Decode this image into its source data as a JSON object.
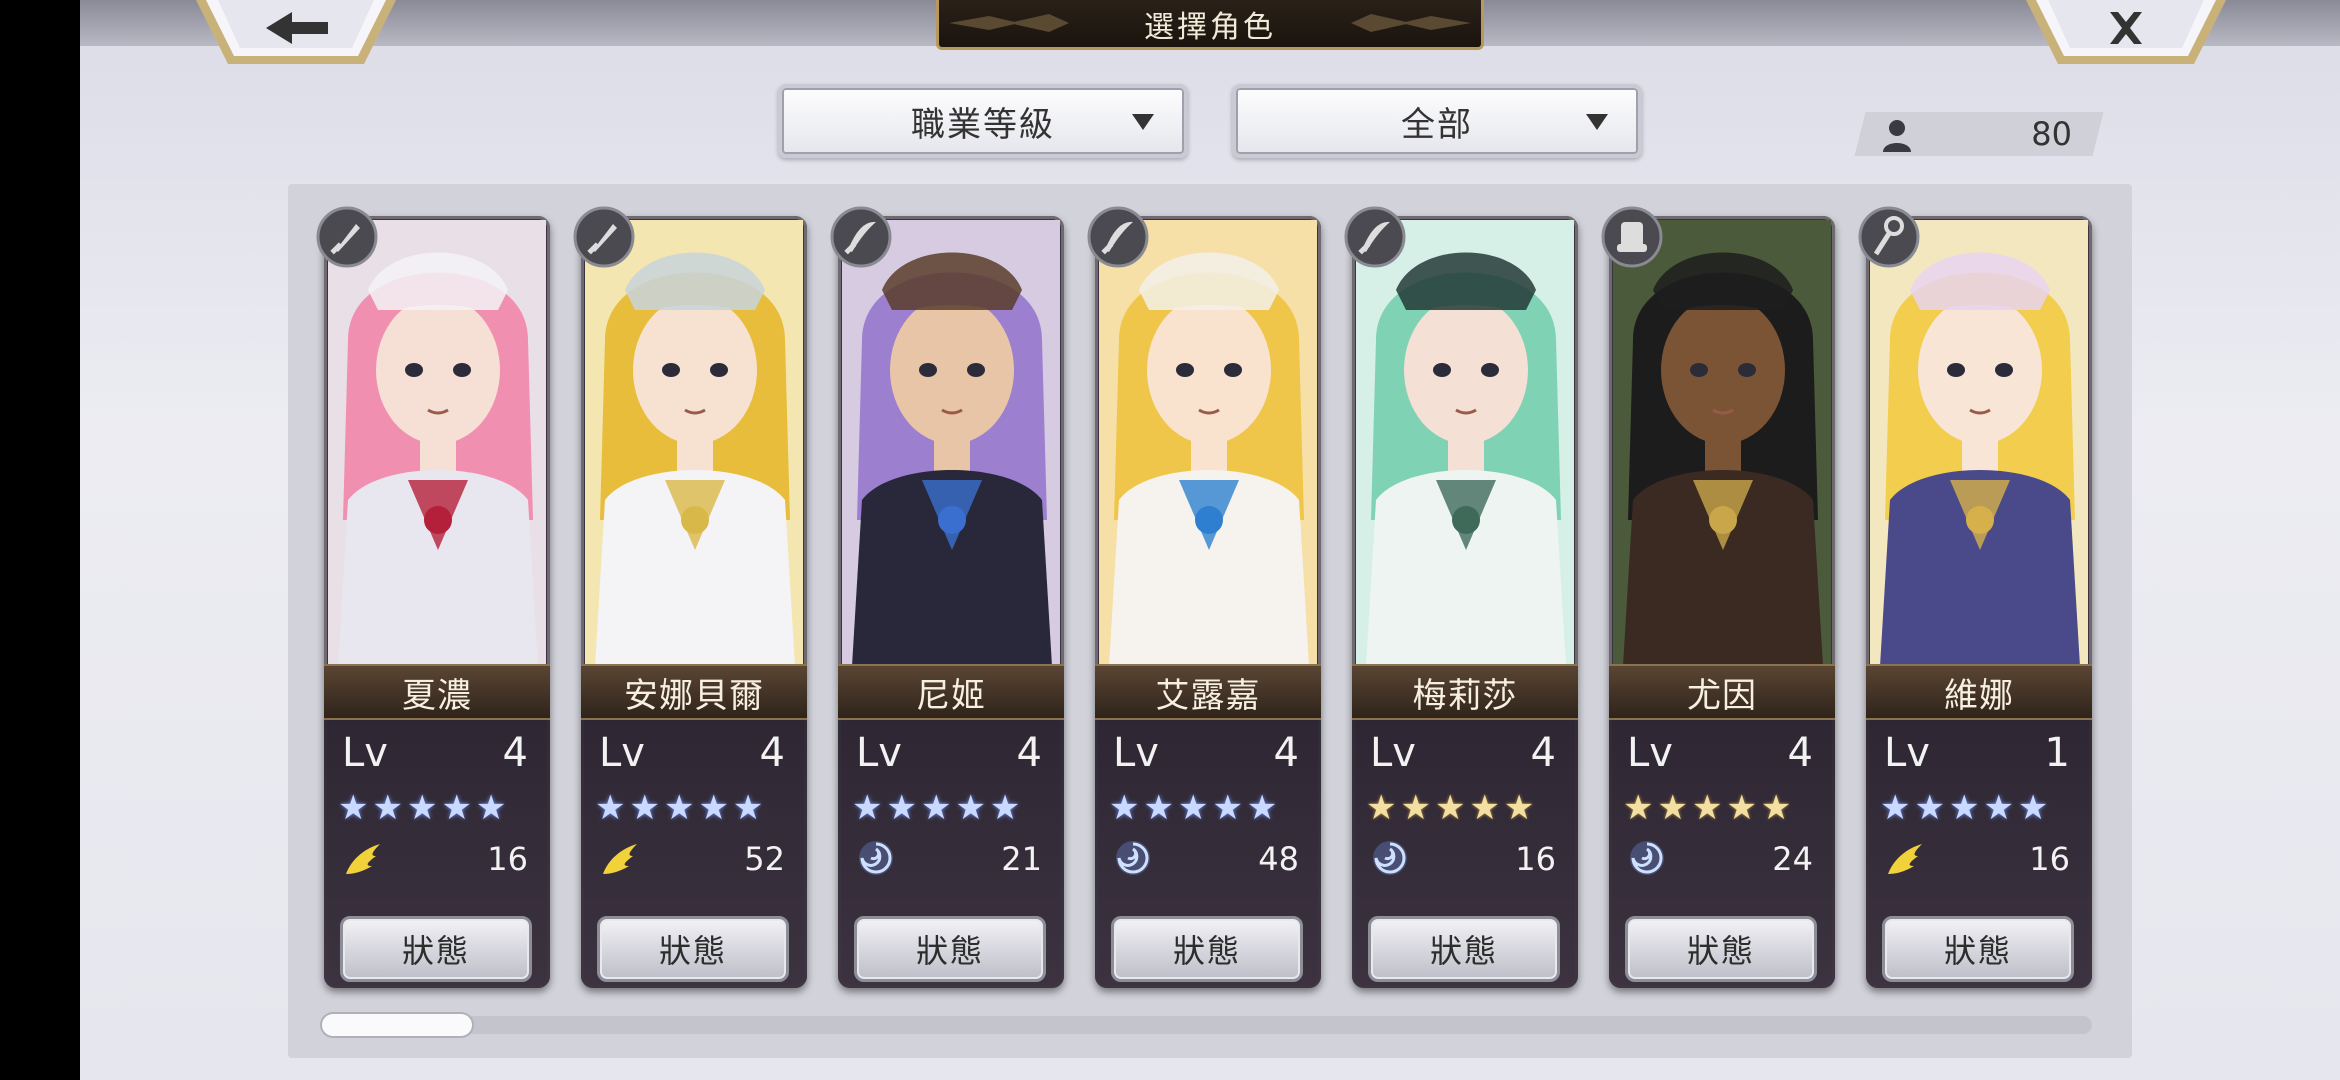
{
  "header": {
    "title": "選擇角色",
    "back_icon": "arrow-left-icon",
    "close_icon": "close-icon"
  },
  "filters": {
    "sort_label": "職業等級",
    "category_label": "全部"
  },
  "character_count": {
    "icon": "person-icon",
    "value": "80"
  },
  "colors": {
    "accent_gold": "#b79a5b",
    "star_blue": "#c9d9ff",
    "star_gold": "#f3dfa2",
    "name_bar": "#4a3a2b"
  },
  "characters": [
    {
      "name": "夏濃",
      "lv_label": "Lv",
      "level": "4",
      "stars": "★★★★★",
      "star_color": "blue",
      "element_icon": "wing-icon",
      "element_value": "16",
      "status_label": "狀態",
      "class_icon": "sword-icon"
    },
    {
      "name": "安娜貝爾",
      "lv_label": "Lv",
      "level": "4",
      "stars": "★★★★★",
      "star_color": "blue",
      "element_icon": "wing-icon",
      "element_value": "52",
      "status_label": "狀態",
      "class_icon": "sword-icon"
    },
    {
      "name": "尼姬",
      "lv_label": "Lv",
      "level": "4",
      "stars": "★★★★★",
      "star_color": "blue",
      "element_icon": "swirl-icon",
      "element_value": "21",
      "status_label": "狀態",
      "class_icon": "blade-icon"
    },
    {
      "name": "艾露嘉",
      "lv_label": "Lv",
      "level": "4",
      "stars": "★★★★★",
      "star_color": "blue",
      "element_icon": "swirl-icon",
      "element_value": "48",
      "status_label": "狀態",
      "class_icon": "blade-icon"
    },
    {
      "name": "梅莉莎",
      "lv_label": "Lv",
      "level": "4",
      "stars": "★★★★★",
      "star_color": "gold",
      "element_icon": "swirl-icon",
      "element_value": "16",
      "status_label": "狀態",
      "class_icon": "blade-icon"
    },
    {
      "name": "尤因",
      "lv_label": "Lv",
      "level": "4",
      "stars": "★★★★★",
      "star_color": "gold",
      "element_icon": "swirl-icon",
      "element_value": "24",
      "status_label": "狀態",
      "class_icon": "gauntlet-icon"
    },
    {
      "name": "維娜",
      "lv_label": "Lv",
      "level": "1",
      "stars": "★★★★★",
      "star_color": "blue",
      "element_icon": "wing-icon",
      "element_value": "16",
      "status_label": "狀態",
      "class_icon": "staff-icon"
    }
  ],
  "scroll": {
    "position": 0
  }
}
